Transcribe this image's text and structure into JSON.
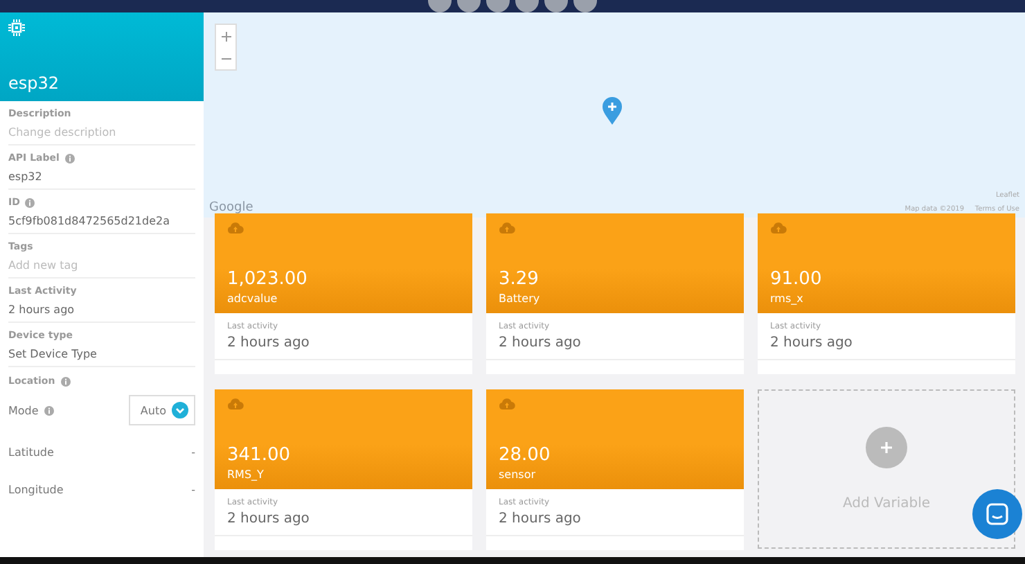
{
  "device": {
    "name": "esp32"
  },
  "fields": [
    {
      "label": "Description",
      "placeholder": "Change description",
      "info": false
    },
    {
      "label": "API Label",
      "value": "esp32",
      "info": true
    },
    {
      "label": "ID",
      "value": "5cf9fb081d8472565d21de2a",
      "info": true
    },
    {
      "label": "Tags",
      "placeholder": "Add new tag",
      "info": false
    },
    {
      "label": "Last Activity",
      "value": "2 hours ago",
      "info": false
    },
    {
      "label": "Device type",
      "value": "Set Device Type",
      "info": false
    }
  ],
  "location": {
    "label": "Location",
    "mode_label": "Mode",
    "mode": "Auto",
    "rows": [
      {
        "label": "Latitude",
        "value": "-"
      },
      {
        "label": "Longitude",
        "value": "-"
      }
    ]
  },
  "map": {
    "attribution": "Google",
    "leaflet": "Leaflet",
    "map_data": "Map data ©2019",
    "terms": "Terms of Use"
  },
  "variables": [
    {
      "value": "1,023.00",
      "name": "adcvalue",
      "activity_label": "Last activity",
      "activity": "2 hours ago"
    },
    {
      "value": "3.29",
      "name": "Battery",
      "activity_label": "Last activity",
      "activity": "2 hours ago"
    },
    {
      "value": "91.00",
      "name": "rms_x",
      "activity_label": "Last activity",
      "activity": "2 hours ago"
    },
    {
      "value": "341.00",
      "name": "RMS_Y",
      "activity_label": "Last activity",
      "activity": "2 hours ago"
    },
    {
      "value": "28.00",
      "name": "sensor",
      "activity_label": "Last activity",
      "activity": "2 hours ago"
    }
  ],
  "add_card": {
    "label": "Add Variable"
  }
}
